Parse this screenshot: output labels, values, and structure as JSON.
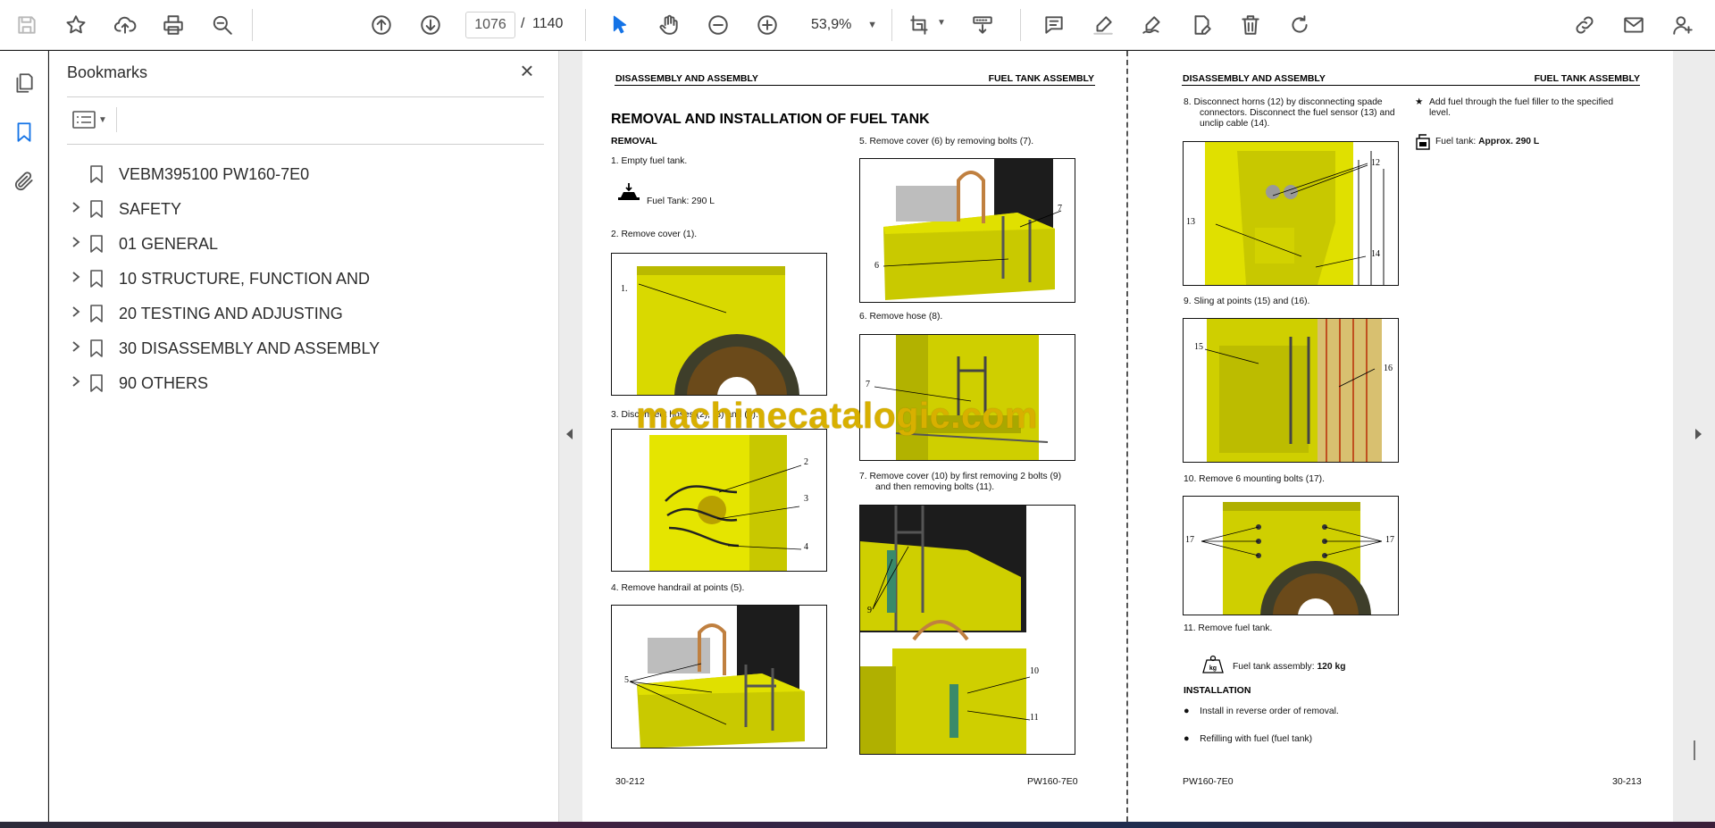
{
  "toolbar": {
    "current_page": "1076",
    "page_separator": "/",
    "total_pages": "1140",
    "zoom": "53,9%"
  },
  "bookmarks": {
    "title": "Bookmarks",
    "items": [
      {
        "label": "VEBM395100 PW160-7E0",
        "expandable": false
      },
      {
        "label": "SAFETY",
        "expandable": true
      },
      {
        "label": "01 GENERAL",
        "expandable": true
      },
      {
        "label": "10 STRUCTURE, FUNCTION AND",
        "expandable": true
      },
      {
        "label": "20 TESTING AND ADJUSTING",
        "expandable": true
      },
      {
        "label": "30 DISASSEMBLY AND ASSEMBLY",
        "expandable": true
      },
      {
        "label": "90 OTHERS",
        "expandable": true
      }
    ]
  },
  "page_left": {
    "header_left": "DISASSEMBLY AND ASSEMBLY",
    "header_right": "FUEL TANK ASSEMBLY",
    "title": "REMOVAL AND INSTALLATION OF FUEL TANK",
    "removal_heading": "REMOVAL",
    "step1": "1.    Empty fuel tank.",
    "step1_note": "Fuel Tank: 290 L",
    "step2": "2.    Remove cover (1).",
    "step3": "3.    Disconnect hoses (2), (3) and (4).",
    "step4": "4.    Remove handrail at points (5).",
    "step5": "5.    Remove cover (6) by removing bolts (7).",
    "step6": "6.    Remove hose (8).",
    "step7a": "7.    Remove cover (10) by first removing 2 bolts (9)",
    "step7b": "and then removing bolts (11).",
    "footer_left": "30-212",
    "footer_right": "PW160-7E0",
    "callouts": {
      "c1": "1.",
      "c2": "2",
      "c3": "3",
      "c4": "4",
      "c5": "5",
      "c6": "6",
      "c7a": "7",
      "c7b": "7",
      "c9": "9",
      "c10": "10",
      "c11": "11"
    }
  },
  "page_right": {
    "header_left": "DISASSEMBLY AND ASSEMBLY",
    "header_right": "FUEL TANK ASSEMBLY",
    "step8a": "8.    Disconnect horns (12) by disconnecting spade",
    "step8b": "connectors. Disconnect the fuel sensor (13) and",
    "step8c": "unclip cable (14).",
    "step9": "9.    Sling at points (15) and (16).",
    "step10": "10.  Remove 6 mounting bolts (17).",
    "step11": "11.  Remove fuel tank.",
    "weight_label": "Fuel tank assembly: ",
    "weight_value": "120 kg",
    "installation_heading": "INSTALLATION",
    "inst1": "Install in reverse order of removal.",
    "inst2": "Refilling with fuel (fuel tank)",
    "star_note_a": "Add fuel through the fuel filler to the specified",
    "star_note_b": "level.",
    "capacity_label": "Fuel tank: ",
    "capacity_value": "Approx. 290 L",
    "footer_left": "PW160-7E0",
    "footer_right": "30-213",
    "callouts": {
      "c12": "12",
      "c13": "13",
      "c14": "14",
      "c15": "15",
      "c16": "16",
      "c17a": "17",
      "c17b": "17"
    }
  },
  "watermark": "machinecatalogic.com",
  "colors": {
    "accent": "#1473e6",
    "machine_yellow": "#d9d900",
    "watermark": "#d8b000"
  }
}
